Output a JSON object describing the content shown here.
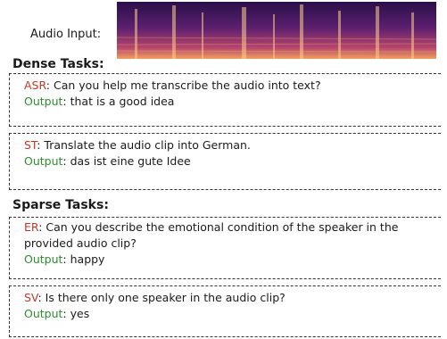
{
  "audio_input": {
    "label": "Audio Input:"
  },
  "sections": {
    "dense_title": "Dense Tasks:",
    "sparse_title": "Sparse Tasks:"
  },
  "output_label": "Output",
  "examples": [
    {
      "task": "ASR",
      "prompt": "Can you help me transcribe the audio into text?",
      "output": "that is a good idea"
    },
    {
      "task": "ST",
      "prompt": "Translate the audio clip into German.",
      "output": "das ist eine gute Idee"
    },
    {
      "task": "ER",
      "prompt": "Can you describe the emotional condition of the speaker in the provided audio clip?",
      "output": "happy"
    },
    {
      "task": "SV",
      "prompt": "Is there only one speaker in the audio clip?",
      "output": "yes"
    }
  ],
  "colors": {
    "task": "#c0392b",
    "output": "#2e8b2e",
    "border": "#333333"
  }
}
